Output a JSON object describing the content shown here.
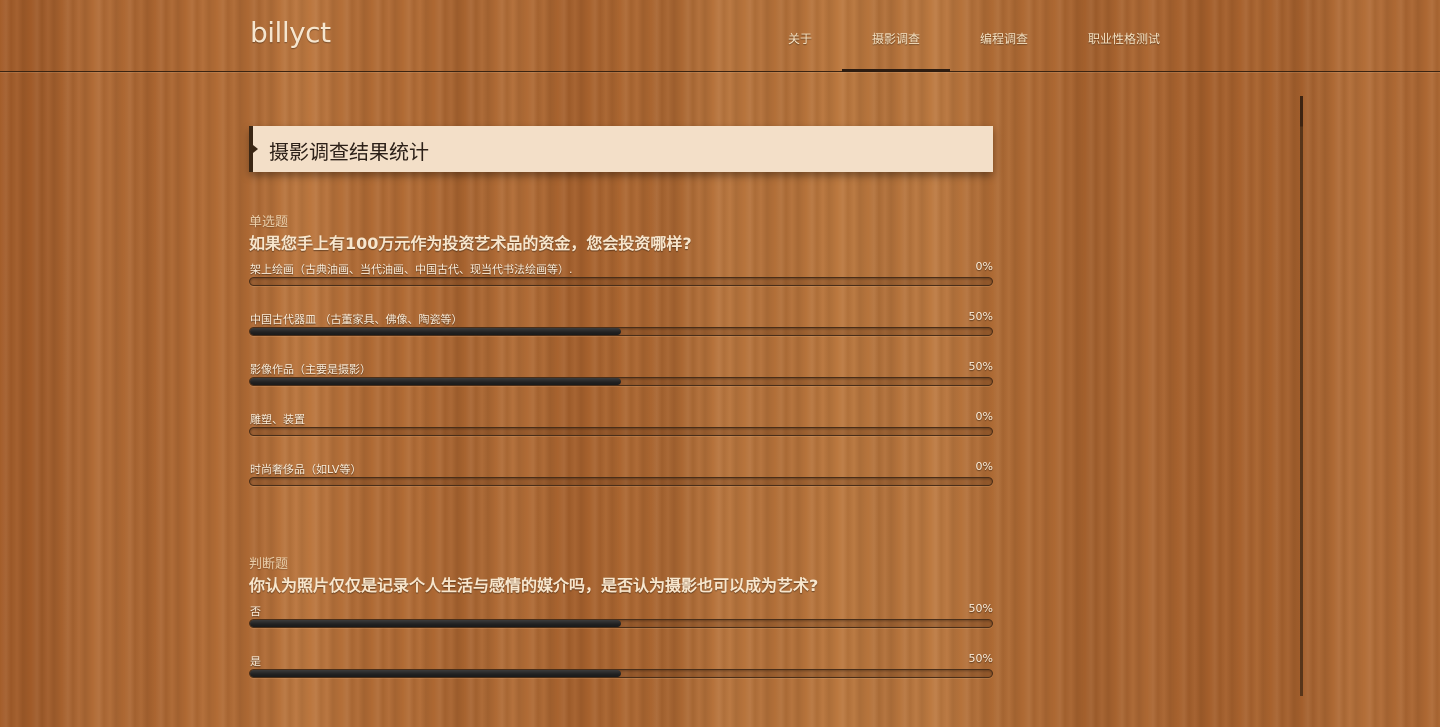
{
  "header": {
    "logo": "billyct",
    "nav": [
      {
        "label": "关于",
        "active": false
      },
      {
        "label": "摄影调查",
        "active": true
      },
      {
        "label": "编程调查",
        "active": false
      },
      {
        "label": "职业性格测试",
        "active": false
      }
    ]
  },
  "page": {
    "title": "摄影调查结果统计"
  },
  "questions": [
    {
      "type": "单选题",
      "text": "如果您手上有100万元作为投资艺术品的资金，您会投资哪样?",
      "options": [
        {
          "label": "架上绘画（古典油画、当代油画、中国古代、现当代书法绘画等）.",
          "percent_text": "0%",
          "percent": 0
        },
        {
          "label": "中国古代器皿 （古董家具、佛像、陶瓷等）",
          "percent_text": "50%",
          "percent": 50
        },
        {
          "label": "影像作品（主要是摄影）",
          "percent_text": "50%",
          "percent": 50
        },
        {
          "label": "雕塑、装置",
          "percent_text": "0%",
          "percent": 0
        },
        {
          "label": "时尚奢侈品（如LV等）",
          "percent_text": "0%",
          "percent": 0
        }
      ]
    },
    {
      "type": "判断题",
      "text": "你认为照片仅仅是记录个人生活与感情的媒介吗，是否认为摄影也可以成为艺术?",
      "options": [
        {
          "label": "否",
          "percent_text": "50%",
          "percent": 50
        },
        {
          "label": "是",
          "percent_text": "50%",
          "percent": 50
        }
      ]
    }
  ],
  "colors": {
    "bar_fill": "#222222",
    "banner_bg": "#f3dfc8",
    "text_light": "#f7e6cd"
  }
}
